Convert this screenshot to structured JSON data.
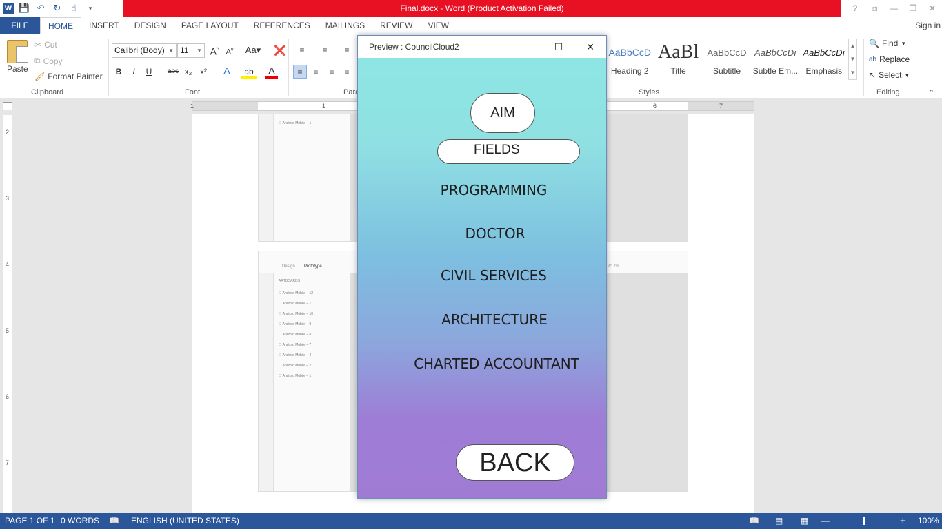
{
  "window": {
    "title": "Final.docx -  Word (Product Activation Failed)",
    "controls": [
      "?",
      "⧉",
      "—",
      "❐",
      "✕"
    ]
  },
  "qat": {
    "app_icon": "word-icon",
    "save": "save-icon",
    "undo": "undo-icon",
    "redo": "redo-icon",
    "touch": "touch-mode-icon"
  },
  "tabs": [
    "FILE",
    "HOME",
    "INSERT",
    "DESIGN",
    "PAGE LAYOUT",
    "REFERENCES",
    "MAILINGS",
    "REVIEW",
    "VIEW"
  ],
  "active_tab": "HOME",
  "signin": "Sign in",
  "clipboard": {
    "paste": "Paste",
    "cut": "Cut",
    "copy": "Copy",
    "format_painter": "Format Painter",
    "label": "Clipboard"
  },
  "font": {
    "family": "Calibri (Body)",
    "size": "11",
    "label": "Font",
    "buttons": [
      "B",
      "I",
      "U",
      "abc",
      "x₂",
      "x²"
    ]
  },
  "paragraph": {
    "label": "Para"
  },
  "styles": {
    "label": "Styles",
    "items": [
      {
        "sample": "AaBbCcD",
        "name": "Heading 2"
      },
      {
        "sample": "AaBl",
        "name": "Title"
      },
      {
        "sample": "AaBbCcD",
        "name": "Subtitle"
      },
      {
        "sample": "AaBbCcDı",
        "name": "Subtle Em..."
      },
      {
        "sample": "AaBbCcDı",
        "name": "Emphasis"
      }
    ]
  },
  "editing": {
    "label": "Editing",
    "find": "Find",
    "replace": "Replace",
    "select": "Select"
  },
  "ruler": {
    "h_numbers": [
      "1",
      "1",
      "6",
      "7"
    ],
    "v_numbers": [
      "2",
      "3",
      "4",
      "5",
      "6",
      "7"
    ]
  },
  "doc_shots": {
    "top_list": [
      "Android Mobile – 1"
    ],
    "bottom_tabs": [
      "Design",
      "Prototype"
    ],
    "bottom_header": "ARTBOARDS",
    "bottom_list": [
      "Android Mobile – 12",
      "Android Mobile – 11",
      "Android Mobile – 10",
      "Android Mobile – 9",
      "Android Mobile – 8",
      "Android Mobile – 7",
      "Android Mobile – 4",
      "Android Mobile – 2",
      "Android Mobile – 1"
    ],
    "zoom": "20.7%"
  },
  "preview": {
    "title": "Preview : CouncilCloud2",
    "aim": "AIM",
    "fields": "FIELDS",
    "items": [
      "PROGRAMMING",
      "DOCTOR",
      "CIVIL SERVICES",
      "ARCHITECTURE",
      "CHARTED ACCOUNTANT"
    ],
    "back": "BACK"
  },
  "status": {
    "page": "PAGE 1 OF 1",
    "words": "0 WORDS",
    "language": "ENGLISH (UNITED STATES)",
    "zoom": "100%"
  }
}
